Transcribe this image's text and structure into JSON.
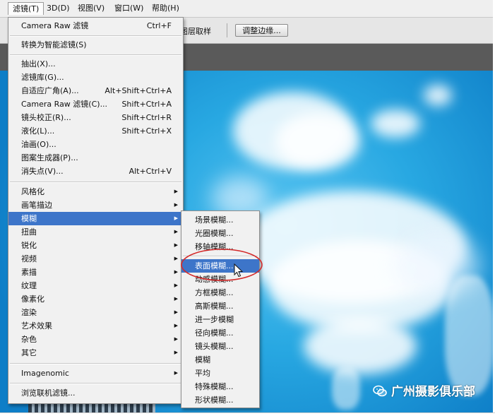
{
  "menubar": {
    "items": [
      {
        "label": "滤镜(T)",
        "active": true
      },
      {
        "label": "3D(D)"
      },
      {
        "label": "视图(V)"
      },
      {
        "label": "窗口(W)"
      },
      {
        "label": "帮助(H)"
      }
    ]
  },
  "options_bar": {
    "sample_text": "图层取样",
    "refine_edge_label": "调整边缘..."
  },
  "filter_menu": {
    "items": [
      {
        "label": "Camera Raw 滤镜",
        "shortcut": "Ctrl+F"
      },
      {
        "label": "转换为智能滤镜(S)"
      },
      {
        "label": "抽出(X)..."
      },
      {
        "label": "滤镜库(G)..."
      },
      {
        "label": "自适应广角(A)...",
        "shortcut": "Alt+Shift+Ctrl+A"
      },
      {
        "label": "Camera Raw 滤镜(C)...",
        "shortcut": "Shift+Ctrl+A"
      },
      {
        "label": "镜头校正(R)...",
        "shortcut": "Shift+Ctrl+R"
      },
      {
        "label": "液化(L)...",
        "shortcut": "Shift+Ctrl+X"
      },
      {
        "label": "油画(O)..."
      },
      {
        "label": "图案生成器(P)..."
      },
      {
        "label": "消失点(V)...",
        "shortcut": "Alt+Ctrl+V"
      },
      {
        "label": "风格化"
      },
      {
        "label": "画笔描边"
      },
      {
        "label": "模糊"
      },
      {
        "label": "扭曲"
      },
      {
        "label": "锐化"
      },
      {
        "label": "视频"
      },
      {
        "label": "素描"
      },
      {
        "label": "纹理"
      },
      {
        "label": "像素化"
      },
      {
        "label": "渲染"
      },
      {
        "label": "艺术效果"
      },
      {
        "label": "杂色"
      },
      {
        "label": "其它"
      },
      {
        "label": "Imagenomic"
      },
      {
        "label": "浏览联机滤镜..."
      }
    ]
  },
  "blur_submenu": {
    "items": [
      {
        "label": "场景模糊..."
      },
      {
        "label": "光圈模糊..."
      },
      {
        "label": "移轴模糊..."
      },
      {
        "label": "表面模糊..."
      },
      {
        "label": "动感模糊..."
      },
      {
        "label": "方框模糊..."
      },
      {
        "label": "高斯模糊..."
      },
      {
        "label": "进一步模糊"
      },
      {
        "label": "径向模糊..."
      },
      {
        "label": "镜头模糊..."
      },
      {
        "label": "模糊"
      },
      {
        "label": "平均"
      },
      {
        "label": "特殊模糊..."
      },
      {
        "label": "形状模糊..."
      }
    ]
  },
  "watermark": {
    "text": "广州摄影俱乐部",
    "icon": "wechat-icon"
  },
  "colors": {
    "highlight": "#3d75c9",
    "annotation": "#d42a2a",
    "sky": "#28a8e2"
  }
}
